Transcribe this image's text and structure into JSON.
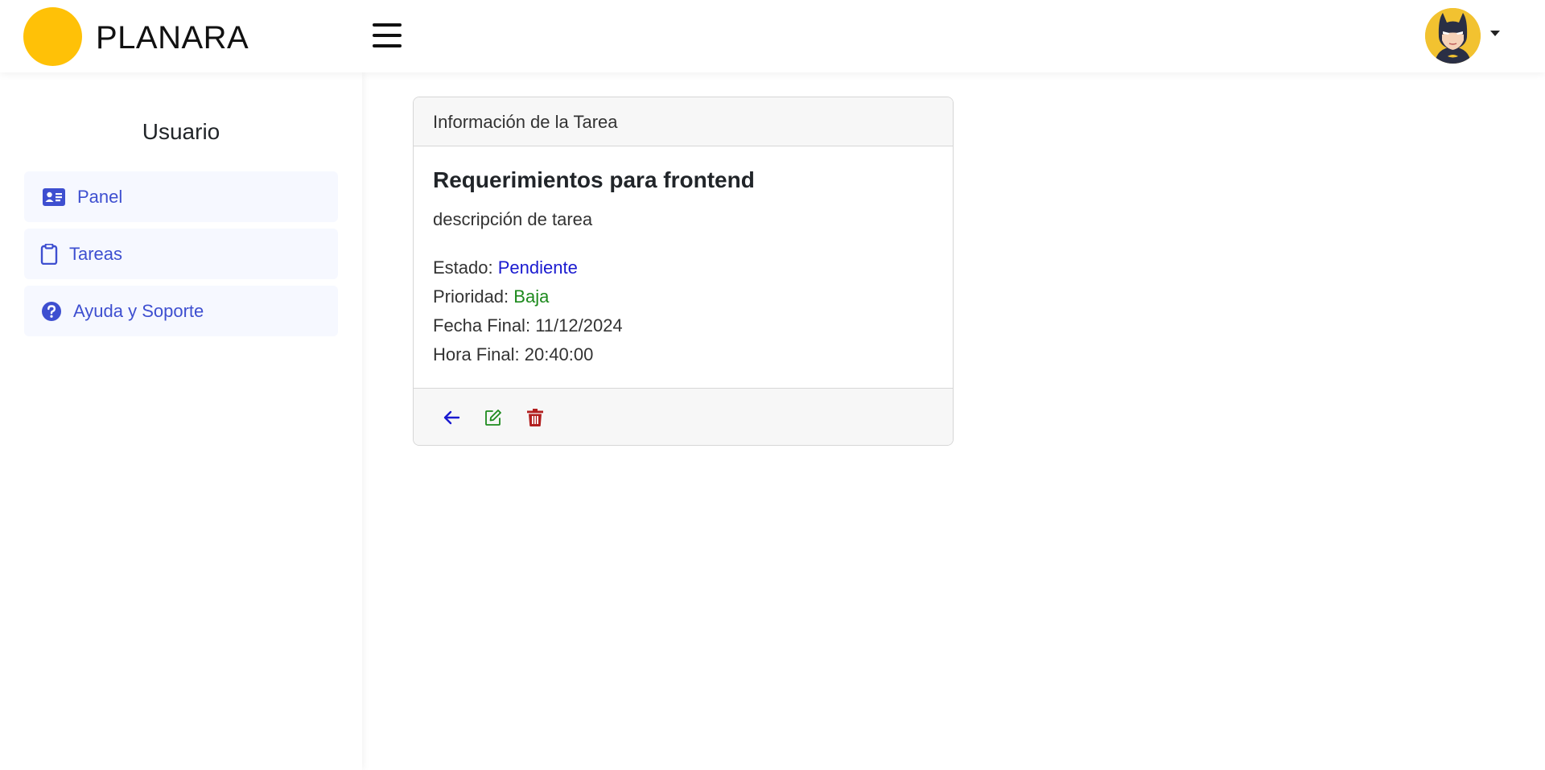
{
  "app": {
    "brand": "PLANARA",
    "logo_color": "#ffc107"
  },
  "header": {
    "menu_icon": "hamburger-icon",
    "avatar_icon": "batman-avatar",
    "dropdown_icon": "caret-down-icon"
  },
  "sidebar": {
    "title": "Usuario",
    "items": [
      {
        "label": "Panel",
        "icon": "id-card-icon"
      },
      {
        "label": "Tareas",
        "icon": "clipboard-icon"
      },
      {
        "label": "Ayuda y Soporte",
        "icon": "question-circle-icon"
      }
    ],
    "accent": "#3e4fd0"
  },
  "task_card": {
    "header": "Información de la Tarea",
    "title": "Requerimientos para frontend",
    "description": "descripción de tarea",
    "status_label": "Estado:",
    "status_value": "Pendiente",
    "priority_label": "Prioridad:",
    "priority_value": "Baja",
    "end_date_label": "Fecha Final:",
    "end_date_value": "11/12/2024",
    "end_time_label": "Hora Final:",
    "end_time_value": "20:40:00",
    "actions": [
      {
        "icon": "arrow-left-icon",
        "color": "#1a1ad0"
      },
      {
        "icon": "edit-icon",
        "color": "#1d8a1d"
      },
      {
        "icon": "trash-icon",
        "color": "#b21f1f"
      }
    ]
  }
}
